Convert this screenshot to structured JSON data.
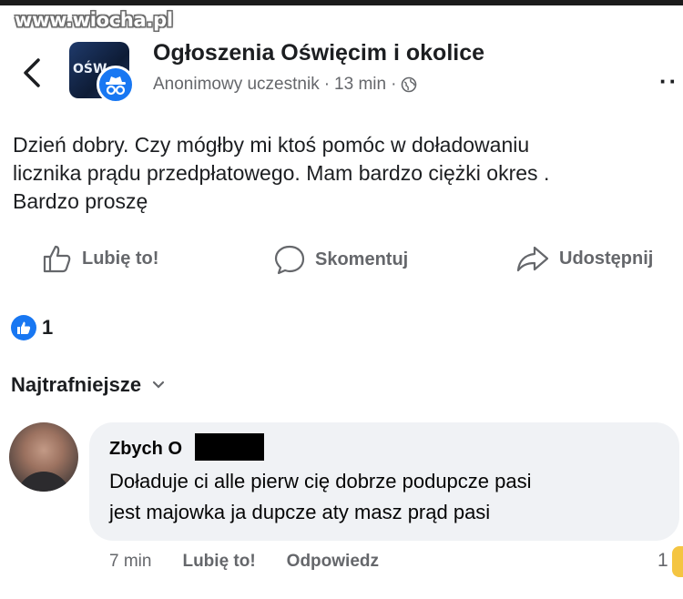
{
  "watermark": "www.wiocha.pl",
  "header": {
    "group_name": "Ogłoszenia Oświęcim i okolice",
    "author": "Anonimowy uczestnik",
    "separator": "·",
    "time": "13 min",
    "avatar_text": "OŚW",
    "more": "··"
  },
  "post": {
    "lines": [
      "Dzień dobry.  Czy mógłby mi ktoś pomóc w doładowaniu",
      "licznika prądu przedpłatowego. Mam bardzo ciężki okres .",
      "Bardzo proszę"
    ]
  },
  "actions": {
    "like": "Lubię to!",
    "comment": "Skomentuj",
    "share": "Udostępnij"
  },
  "reactions": {
    "count": "1"
  },
  "sort": {
    "label": "Najtrafniejsze"
  },
  "comment": {
    "author": "Zbych O",
    "lines": [
      "Doładuje ci alle pierw cię dobrze podupcze pasi",
      "jest majowka ja dupcze aty masz prąd pasi"
    ],
    "time": "7 min",
    "like": "Lubię to!",
    "reply": "Odpowiedz",
    "reaction_count": "1"
  },
  "colors": {
    "accent": "#1877f2",
    "secondary_text": "#65676b",
    "bubble": "#f0f2f5"
  },
  "icons": [
    "back-arrow-icon",
    "anonymous-icon",
    "globe-icon",
    "more-icon",
    "thumbs-up-icon",
    "comment-icon",
    "share-icon",
    "chevron-down-icon"
  ]
}
